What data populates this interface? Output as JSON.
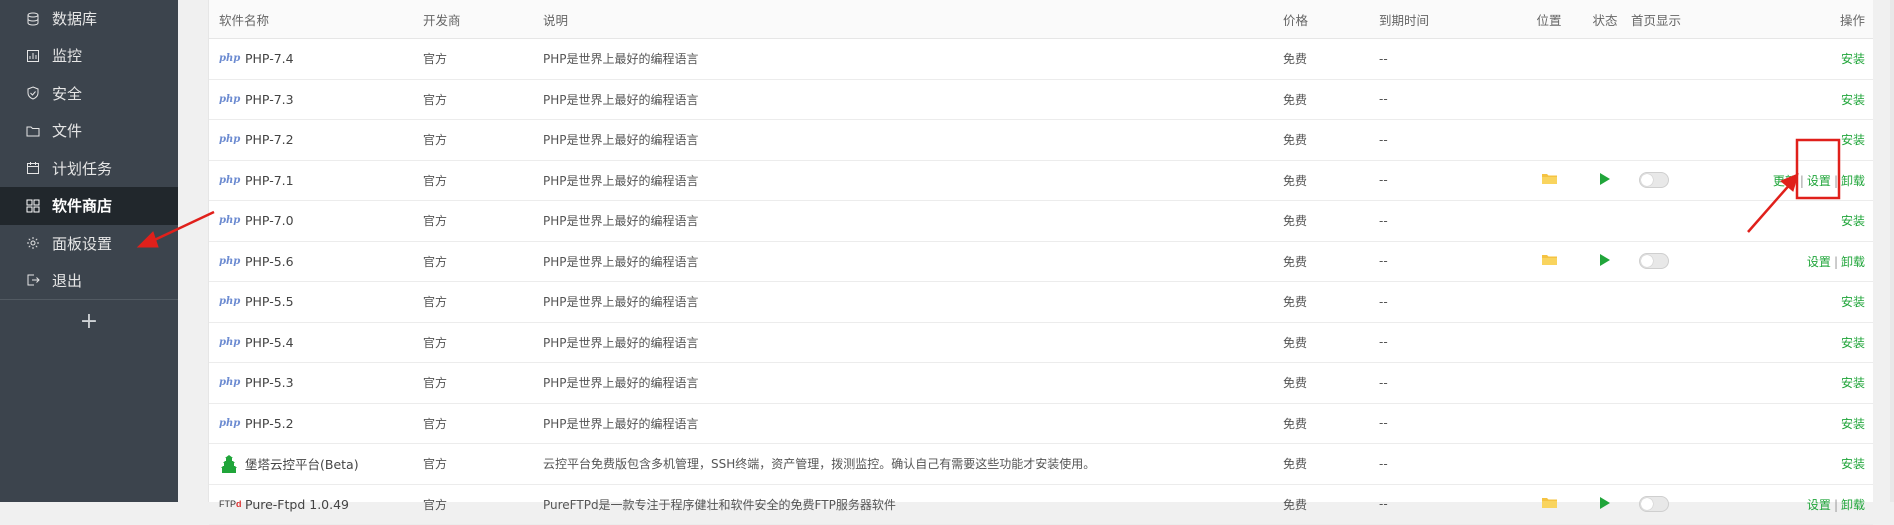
{
  "sidebar": {
    "items": [
      {
        "label": "数据库",
        "icon": "database-icon"
      },
      {
        "label": "监控",
        "icon": "monitor-icon"
      },
      {
        "label": "安全",
        "icon": "shield-icon"
      },
      {
        "label": "文件",
        "icon": "folder-icon"
      },
      {
        "label": "计划任务",
        "icon": "calendar-icon"
      },
      {
        "label": "软件商店",
        "icon": "grid-icon",
        "active": true
      },
      {
        "label": "面板设置",
        "icon": "gear-icon"
      },
      {
        "label": "退出",
        "icon": "logout-icon"
      }
    ],
    "add_label": "+"
  },
  "table": {
    "headers": {
      "name": "软件名称",
      "developer": "开发商",
      "description": "说明",
      "price": "价格",
      "expiry": "到期时间",
      "location": "位置",
      "status": "状态",
      "homepage": "首页显示",
      "actions": "操作"
    },
    "rows": [
      {
        "logo": "php",
        "name": "PHP-7.4",
        "developer": "官方",
        "description": "PHP是世界上最好的编程语言",
        "price": "免费",
        "expiry": "--",
        "installed": false,
        "actions": [
          "安装"
        ]
      },
      {
        "logo": "php",
        "name": "PHP-7.3",
        "developer": "官方",
        "description": "PHP是世界上最好的编程语言",
        "price": "免费",
        "expiry": "--",
        "installed": false,
        "actions": [
          "安装"
        ]
      },
      {
        "logo": "php",
        "name": "PHP-7.2",
        "developer": "官方",
        "description": "PHP是世界上最好的编程语言",
        "price": "免费",
        "expiry": "--",
        "installed": false,
        "actions": [
          "安装"
        ]
      },
      {
        "logo": "php",
        "name": "PHP-7.1",
        "developer": "官方",
        "description": "PHP是世界上最好的编程语言",
        "price": "免费",
        "expiry": "--",
        "installed": true,
        "actions": [
          "更新",
          "设置",
          "卸载"
        ]
      },
      {
        "logo": "php",
        "name": "PHP-7.0",
        "developer": "官方",
        "description": "PHP是世界上最好的编程语言",
        "price": "免费",
        "expiry": "--",
        "installed": false,
        "actions": [
          "安装"
        ]
      },
      {
        "logo": "php",
        "name": "PHP-5.6",
        "developer": "官方",
        "description": "PHP是世界上最好的编程语言",
        "price": "免费",
        "expiry": "--",
        "installed": true,
        "actions": [
          "设置",
          "卸载"
        ]
      },
      {
        "logo": "php",
        "name": "PHP-5.5",
        "developer": "官方",
        "description": "PHP是世界上最好的编程语言",
        "price": "免费",
        "expiry": "--",
        "installed": false,
        "actions": [
          "安装"
        ]
      },
      {
        "logo": "php",
        "name": "PHP-5.4",
        "developer": "官方",
        "description": "PHP是世界上最好的编程语言",
        "price": "免费",
        "expiry": "--",
        "installed": false,
        "actions": [
          "安装"
        ]
      },
      {
        "logo": "php",
        "name": "PHP-5.3",
        "developer": "官方",
        "description": "PHP是世界上最好的编程语言",
        "price": "免费",
        "expiry": "--",
        "installed": false,
        "actions": [
          "安装"
        ]
      },
      {
        "logo": "php",
        "name": "PHP-5.2",
        "developer": "官方",
        "description": "PHP是世界上最好的编程语言",
        "price": "免费",
        "expiry": "--",
        "installed": false,
        "actions": [
          "安装"
        ]
      },
      {
        "logo": "fort",
        "name": "堡塔云控平台(Beta)",
        "developer": "官方",
        "description": "云控平台免费版包含多机管理，SSH终端，资产管理，拨测监控。确认自己有需要这些功能才安装使用。",
        "price": "免费",
        "expiry": "--",
        "installed": false,
        "actions": [
          "安装"
        ]
      },
      {
        "logo": "ftp",
        "name": "Pure-Ftpd 1.0.49",
        "developer": "官方",
        "description": "PureFTPd是一款专注于程序健壮和软件安全的免费FTP服务器软件",
        "price": "免费",
        "expiry": "--",
        "installed": true,
        "actions": [
          "设置",
          "卸载"
        ]
      }
    ],
    "logo_text": {
      "php": "php",
      "ftp_prefix": "FTP",
      "ftp_mark": "d"
    }
  },
  "colors": {
    "accent": "#20a53a",
    "sidebar_bg": "#3c444d",
    "sidebar_active": "#21272c",
    "annotation": "#e0201b"
  }
}
